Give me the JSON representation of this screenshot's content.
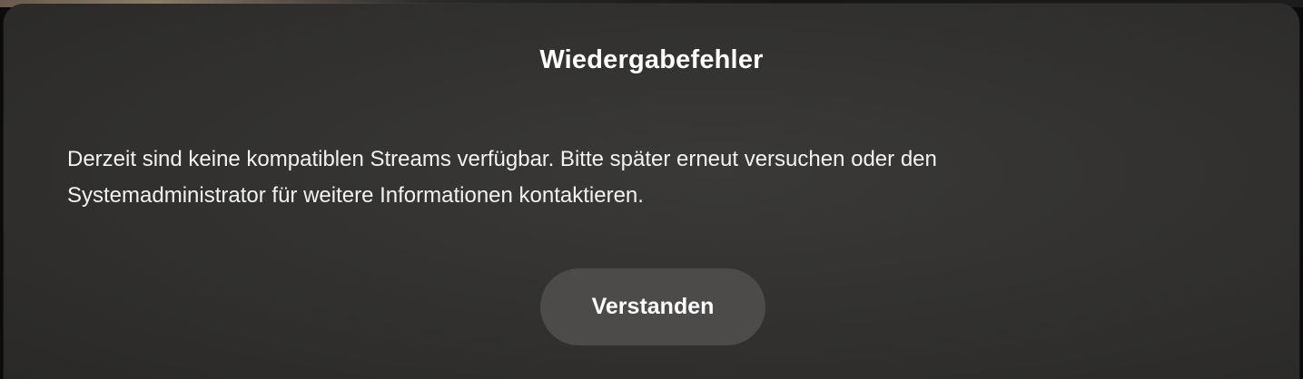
{
  "dialog": {
    "title": "Wiedergabefehler",
    "message_line1": "Derzeit sind keine kompatiblen Streams verfügbar. Bitte später erneut versuchen oder den",
    "message_line2": "Systemadministrator für weitere Informationen kontaktieren.",
    "button_label": "Verstanden"
  },
  "colors": {
    "dialog_background": "#333230",
    "button_background": "#4c4b49",
    "text": "#ffffff"
  }
}
